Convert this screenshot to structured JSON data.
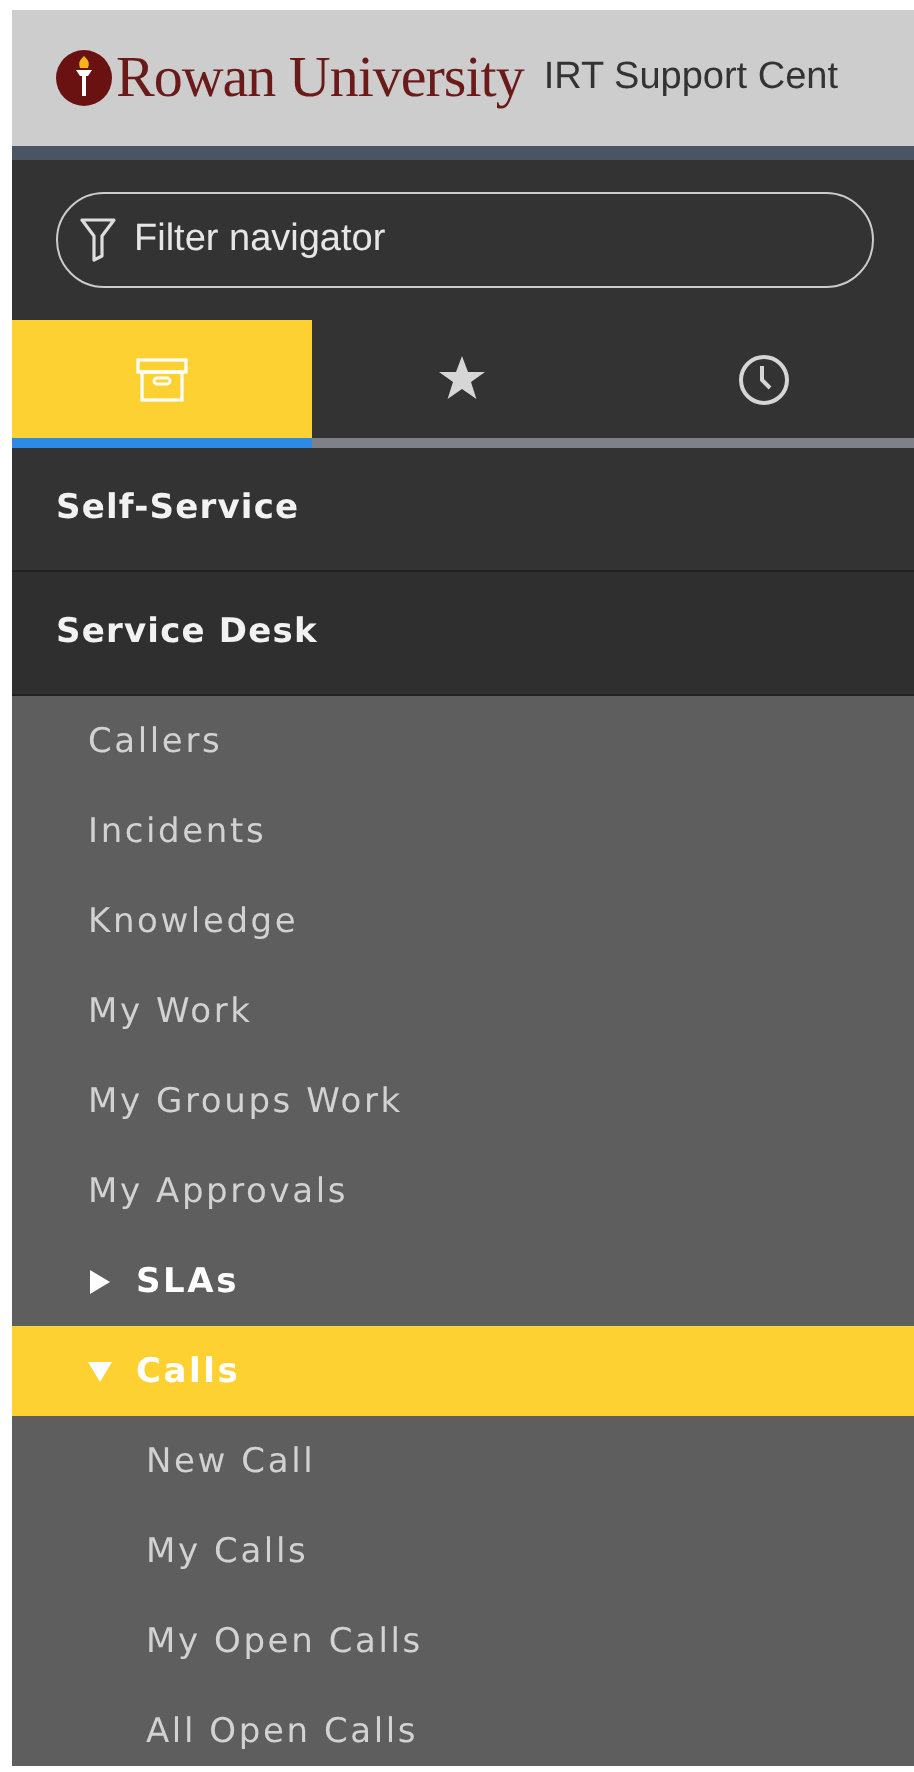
{
  "header": {
    "logo_text": "Rowan University",
    "title": "IRT Support Cent"
  },
  "filter": {
    "placeholder": "Filter navigator"
  },
  "tabs": [
    {
      "kind": "archive",
      "selected": true
    },
    {
      "kind": "star",
      "selected": false
    },
    {
      "kind": "clock",
      "selected": false
    }
  ],
  "nav": [
    {
      "label": "Self-Service",
      "selected": false
    },
    {
      "label": "Service Desk",
      "selected": false,
      "children": [
        {
          "label": "Callers",
          "selected": false
        },
        {
          "label": "Incidents",
          "selected": false
        },
        {
          "label": "Knowledge",
          "selected": false
        },
        {
          "label": "My Work",
          "selected": false
        },
        {
          "label": "My Groups Work",
          "selected": false
        },
        {
          "label": "My Approvals",
          "selected": false
        },
        {
          "label": "SLAs",
          "selected": false,
          "expanded": false
        },
        {
          "label": "Calls",
          "selected": true,
          "expanded": true,
          "children": [
            {
              "label": "New Call",
              "selected": false
            },
            {
              "label": "My Calls",
              "selected": false
            },
            {
              "label": "My Open Calls",
              "selected": false
            },
            {
              "label": "All Open Calls",
              "selected": false
            }
          ]
        }
      ]
    }
  ]
}
